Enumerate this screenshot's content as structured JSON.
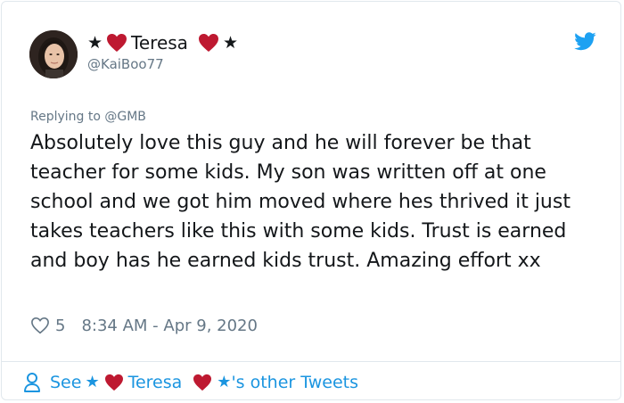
{
  "author": {
    "display_name": "Teresa",
    "star": "★",
    "handle": "@KaiBoo77",
    "verified": false
  },
  "icons": {
    "platform": "twitter-bird-icon",
    "heart": "red-heart-icon",
    "like": "like-heart-outline-icon",
    "profile": "person-icon"
  },
  "colors": {
    "heart": "#be1931",
    "twitter_blue": "#1da1f2",
    "link_blue": "#1b95e0",
    "muted": "#657786"
  },
  "tweet": {
    "replying_to": "Replying to @GMB",
    "text": "Absolutely love this guy and he will forever be that teacher for some kids. My son was written off at one school and we got him moved where hes thrived it just takes teachers like this with some kids. Trust is earned and boy has he earned kids trust. Amazing effort xx",
    "likes": "5",
    "timestamp": "8:34 AM - Apr 9, 2020"
  },
  "footer": {
    "see_prefix": "See",
    "see_name": "Teresa",
    "see_suffix": "'s other Tweets"
  }
}
